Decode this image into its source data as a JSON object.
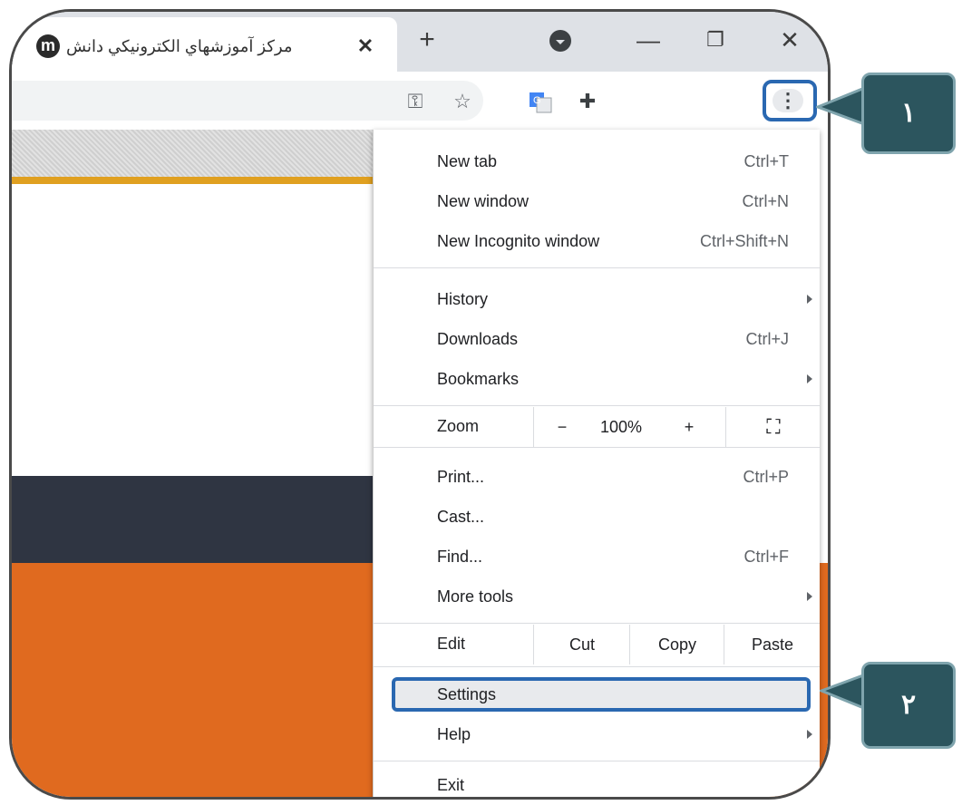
{
  "tab": {
    "title": "مركز آموزشهاي الكترونيكي دانش",
    "favicon": "m",
    "close": "✕"
  },
  "tabbar": {
    "new_tab": "+",
    "minimize": "—",
    "restore": "❐",
    "close": "✕"
  },
  "toolbar": {
    "icons": [
      "key-icon",
      "star-icon",
      "translate-icon",
      "puzzle-icon",
      "kebab-menu-icon"
    ],
    "key": "⚿",
    "star": "☆",
    "puzzle": "✚",
    "menu": "⋮"
  },
  "menu": {
    "items": [
      {
        "label": "New tab",
        "shortcut": "Ctrl+T"
      },
      {
        "label": "New window",
        "shortcut": "Ctrl+N"
      },
      {
        "label": "New Incognito window",
        "shortcut": "Ctrl+Shift+N"
      },
      {
        "label": "History",
        "shortcut": ""
      },
      {
        "label": "Downloads",
        "shortcut": "Ctrl+J"
      },
      {
        "label": "Bookmarks",
        "shortcut": ""
      },
      {
        "label": "Print...",
        "shortcut": "Ctrl+P"
      },
      {
        "label": "Cast...",
        "shortcut": ""
      },
      {
        "label": "Find...",
        "shortcut": "Ctrl+F"
      },
      {
        "label": "More tools",
        "shortcut": ""
      },
      {
        "label": "Settings",
        "shortcut": ""
      },
      {
        "label": "Help",
        "shortcut": ""
      },
      {
        "label": "Exit",
        "shortcut": ""
      }
    ],
    "zoom": {
      "label": "Zoom",
      "minus": "−",
      "value": "100%",
      "plus": "+",
      "fullscreen": "⛶"
    },
    "edit": {
      "label": "Edit",
      "cut": "Cut",
      "copy": "Copy",
      "paste": "Paste"
    }
  },
  "callouts": {
    "one": "١",
    "two": "٢"
  },
  "colors": {
    "highlight_border": "#2a68b1",
    "callout_bg": "#2c555e",
    "page_orange": "#e06a1f",
    "page_dark": "#2f3542",
    "page_gold": "#e0a020"
  }
}
